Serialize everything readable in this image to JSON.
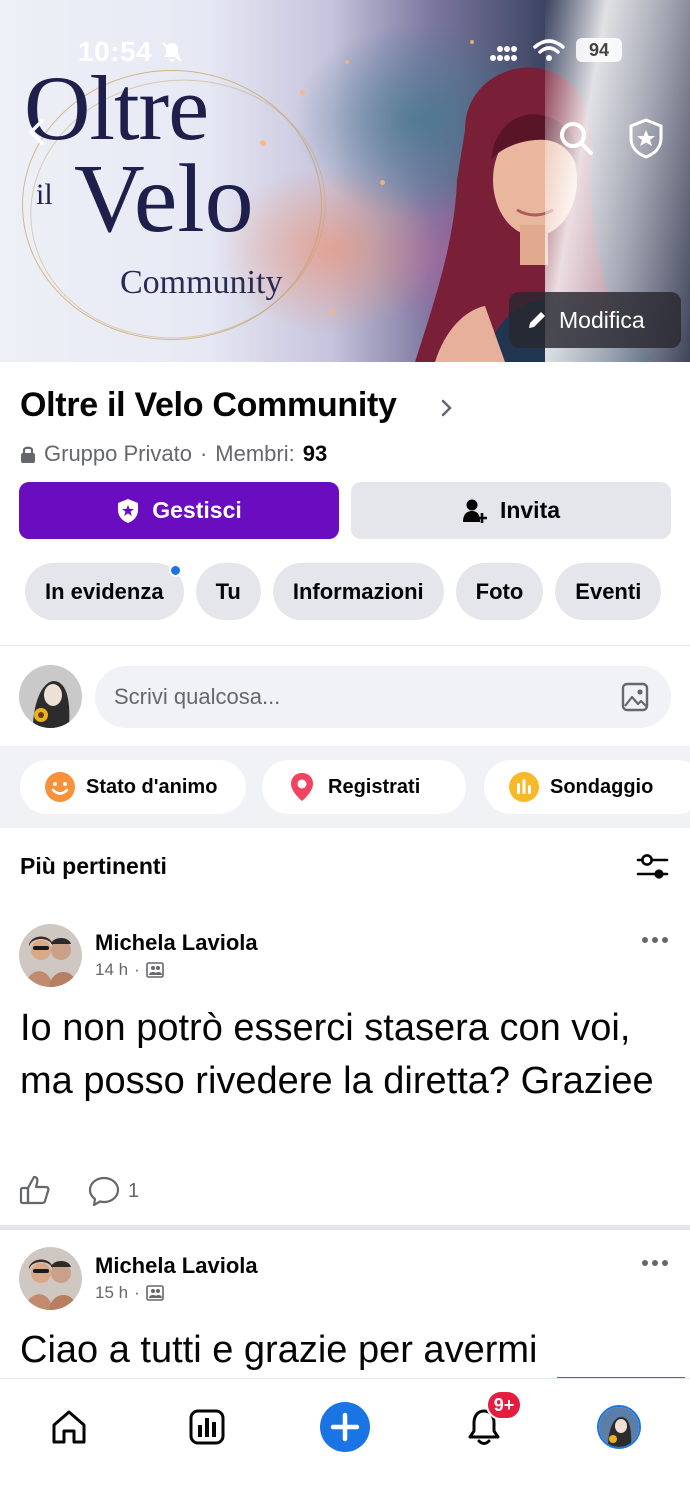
{
  "status_bar": {
    "time": "10:54",
    "battery": "94"
  },
  "cover": {
    "title_line1": "Oltre",
    "title_il": "il",
    "title_line2": "Velo",
    "title_line3": "Community",
    "edit_label": "Modifica"
  },
  "group": {
    "name": "Oltre il Velo Community",
    "privacy": "Gruppo Privato",
    "separator": "·",
    "members_label": "Membri:",
    "members_count": "93",
    "manage_label": "Gestisci",
    "invite_label": "Invita"
  },
  "tabs": [
    {
      "label": "In evidenza",
      "has_dot": true
    },
    {
      "label": "Tu"
    },
    {
      "label": "Informazioni"
    },
    {
      "label": "Foto"
    },
    {
      "label": "Eventi"
    }
  ],
  "composer": {
    "placeholder": "Scrivi qualcosa..."
  },
  "actions": [
    {
      "label": "Stato d'animo",
      "icon": "smiley-icon",
      "color": "#f7923b"
    },
    {
      "label": "Registrati",
      "icon": "location-pin-icon",
      "color": "#f3425f"
    },
    {
      "label": "Sondaggio",
      "icon": "poll-icon",
      "color": "#f7b928"
    }
  ],
  "feed": {
    "sort_label": "Più pertinenti",
    "posts": [
      {
        "author": "Michela Laviola",
        "time": "14 h",
        "text": "Io non potrò  esserci stasera con voi, ma posso rivedere la diretta? Graziee",
        "comments": "1"
      },
      {
        "author": "Michela Laviola",
        "time": "15 h",
        "text": "Ciao a tutti e grazie per avermi"
      }
    ]
  },
  "bottom_nav": {
    "notifications_badge": "9+"
  },
  "colors": {
    "accent": "#1b74e4",
    "manage_button": "#6a0dc0",
    "badge": "#e41e3f"
  }
}
